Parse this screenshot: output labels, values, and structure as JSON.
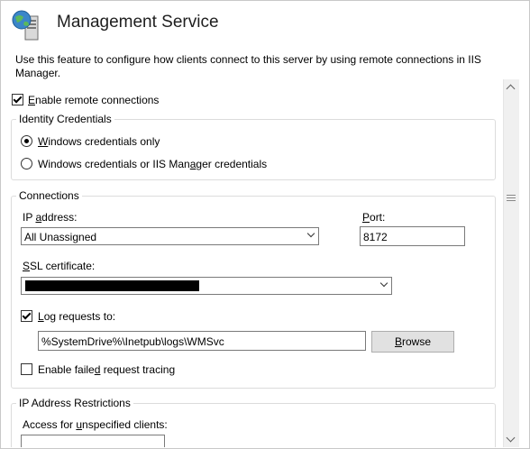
{
  "header": {
    "title": "Management Service",
    "icon": "server-globe-icon",
    "description": "Use this feature to configure how clients connect to this server by using remote connections in IIS Manager."
  },
  "enable_remote": {
    "label": "Enable remote connections",
    "checked": true
  },
  "identity": {
    "legend": "Identity Credentials",
    "options": [
      {
        "label": "Windows credentials only",
        "selected": true
      },
      {
        "label": "Windows credentials or IIS Manager credentials",
        "selected": false
      }
    ]
  },
  "connections": {
    "legend": "Connections",
    "ip_label": "IP address:",
    "ip_value": "All Unassigned",
    "port_label": "Port:",
    "port_value": "8172",
    "ssl_label": "SSL certificate:",
    "ssl_value": "",
    "log_label": "Log requests to:",
    "log_checked": true,
    "log_path": "%SystemDrive%\\Inetpub\\logs\\WMSvc",
    "browse_label": "Browse",
    "failed_label": "Enable failed request tracing",
    "failed_checked": false
  },
  "ip_restrictions": {
    "legend": "IP Address Restrictions",
    "access_label": "Access for unspecified clients:"
  }
}
